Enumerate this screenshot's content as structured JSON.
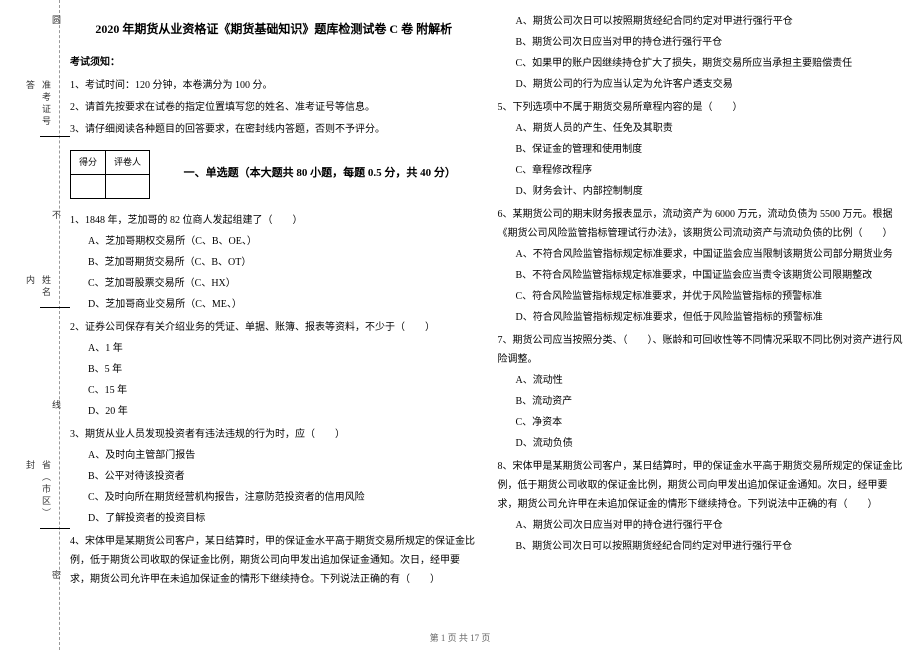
{
  "binding": {
    "top1": "圆",
    "top2": "答",
    "top3": "准考证号",
    "mid1": "不",
    "mid2": "内",
    "mid3": "姓名",
    "bot1": "线",
    "bot2": "封",
    "bot3": "省（市区）",
    "bot4": "密"
  },
  "title": "2020 年期货从业资格证《期货基础知识》题库检测试卷 C 卷  附解析",
  "notice_head": "考试须知：",
  "instructions": [
    "1、考试时间：120 分钟，本卷满分为 100 分。",
    "2、请首先按要求在试卷的指定位置填写您的姓名、准考证号等信息。",
    "3、请仔细阅读各种题目的回答要求，在密封线内答题，否则不予评分。"
  ],
  "score_table": {
    "c1": "得分",
    "c2": "评卷人"
  },
  "part_title": "一、单选题（本大题共 80 小题，每题 0.5 分，共 40 分）",
  "left_questions": [
    {
      "stem": "1、1848 年，芝加哥的 82 位商人发起组建了（　　）",
      "opts": [
        "A、芝加哥期权交易所（C、B、OE、）",
        "B、芝加哥期货交易所（C、B、OT）",
        "C、芝加哥股票交易所（C、HX）",
        "D、芝加哥商业交易所（C、ME、）"
      ]
    },
    {
      "stem": "2、证券公司保存有关介绍业务的凭证、单据、账簿、报表等资料，不少于（　　）",
      "opts": [
        "A、1 年",
        "B、5 年",
        "C、15 年",
        "D、20 年"
      ]
    },
    {
      "stem": "3、期货从业人员发现投资者有违法违规的行为时，应（　　）",
      "opts": [
        "A、及时向主管部门报告",
        "B、公平对待该投资者",
        "C、及时向所在期货经营机构报告，注意防范投资者的信用风险",
        "D、了解投资者的投资目标"
      ]
    },
    {
      "stem": "4、宋体甲是某期货公司客户，某日结算时，甲的保证金水平高于期货交易所规定的保证金比例，低于期货公司收取的保证金比例，期货公司向甲发出追加保证金通知。次日，经甲要求，期货公司允许甲在未追加保证金的情形下继续持仓。下列说法正确的有（　　）",
      "opts": []
    }
  ],
  "right_items": [
    {
      "type": "opt",
      "text": "A、期货公司次日可以按照期货经纪合同约定对甲进行强行平仓"
    },
    {
      "type": "opt",
      "text": "B、期货公司次日应当对甲的持仓进行强行平仓"
    },
    {
      "type": "opt",
      "text": "C、如果甲的账户因继续持仓扩大了损失，期货交易所应当承担主要赔偿责任"
    },
    {
      "type": "opt",
      "text": "D、期货公司的行为应当认定为允许客户透支交易"
    },
    {
      "type": "stem",
      "text": "5、下列选项中不属于期货交易所章程内容的是（　　）"
    },
    {
      "type": "opt",
      "text": "A、期货人员的产生、任免及其职责"
    },
    {
      "type": "opt",
      "text": "B、保证金的管理和使用制度"
    },
    {
      "type": "opt",
      "text": "C、章程修改程序"
    },
    {
      "type": "opt",
      "text": "D、财务会计、内部控制制度"
    },
    {
      "type": "stem",
      "text": "6、某期货公司的期末财务报表显示，流动资产为 6000 万元，流动负债为 5500 万元。根据《期货公司风险监管指标管理试行办法》，该期货公司流动资产与流动负债的比例（　　）"
    },
    {
      "type": "opt",
      "text": "A、不符合风险监管指标规定标准要求，中国证监会应当限制该期货公司部分期货业务"
    },
    {
      "type": "opt",
      "text": "B、不符合风险监管指标规定标准要求，中国证监会应当责令该期货公司限期整改"
    },
    {
      "type": "opt",
      "text": "C、符合风险监管指标规定标准要求，并优于风险监管指标的预警标准"
    },
    {
      "type": "opt",
      "text": "D、符合风险监管指标规定标准要求，但低于风险监管指标的预警标准"
    },
    {
      "type": "stem",
      "text": "7、期货公司应当按照分类、（　　）、账龄和可回收性等不同情况采取不同比例对资产进行风险调整。"
    },
    {
      "type": "opt",
      "text": "A、流动性"
    },
    {
      "type": "opt",
      "text": "B、流动资产"
    },
    {
      "type": "opt",
      "text": "C、净资本"
    },
    {
      "type": "opt",
      "text": "D、流动负债"
    },
    {
      "type": "stem",
      "text": "8、宋体甲是某期货公司客户，某日结算时，甲的保证金水平高于期货交易所规定的保证金比例，低于期货公司收取的保证金比例，期货公司向甲发出追加保证金通知。次日，经甲要求，期货公司允许甲在未追加保证金的情形下继续持仓。下列说法中正确的有（　　）"
    },
    {
      "type": "opt",
      "text": "A、期货公司次日应当对甲的持仓进行强行平仓"
    },
    {
      "type": "opt",
      "text": "B、期货公司次日可以按照期货经纪合同约定对甲进行强行平仓"
    }
  ],
  "footer": "第 1 页 共 17 页"
}
